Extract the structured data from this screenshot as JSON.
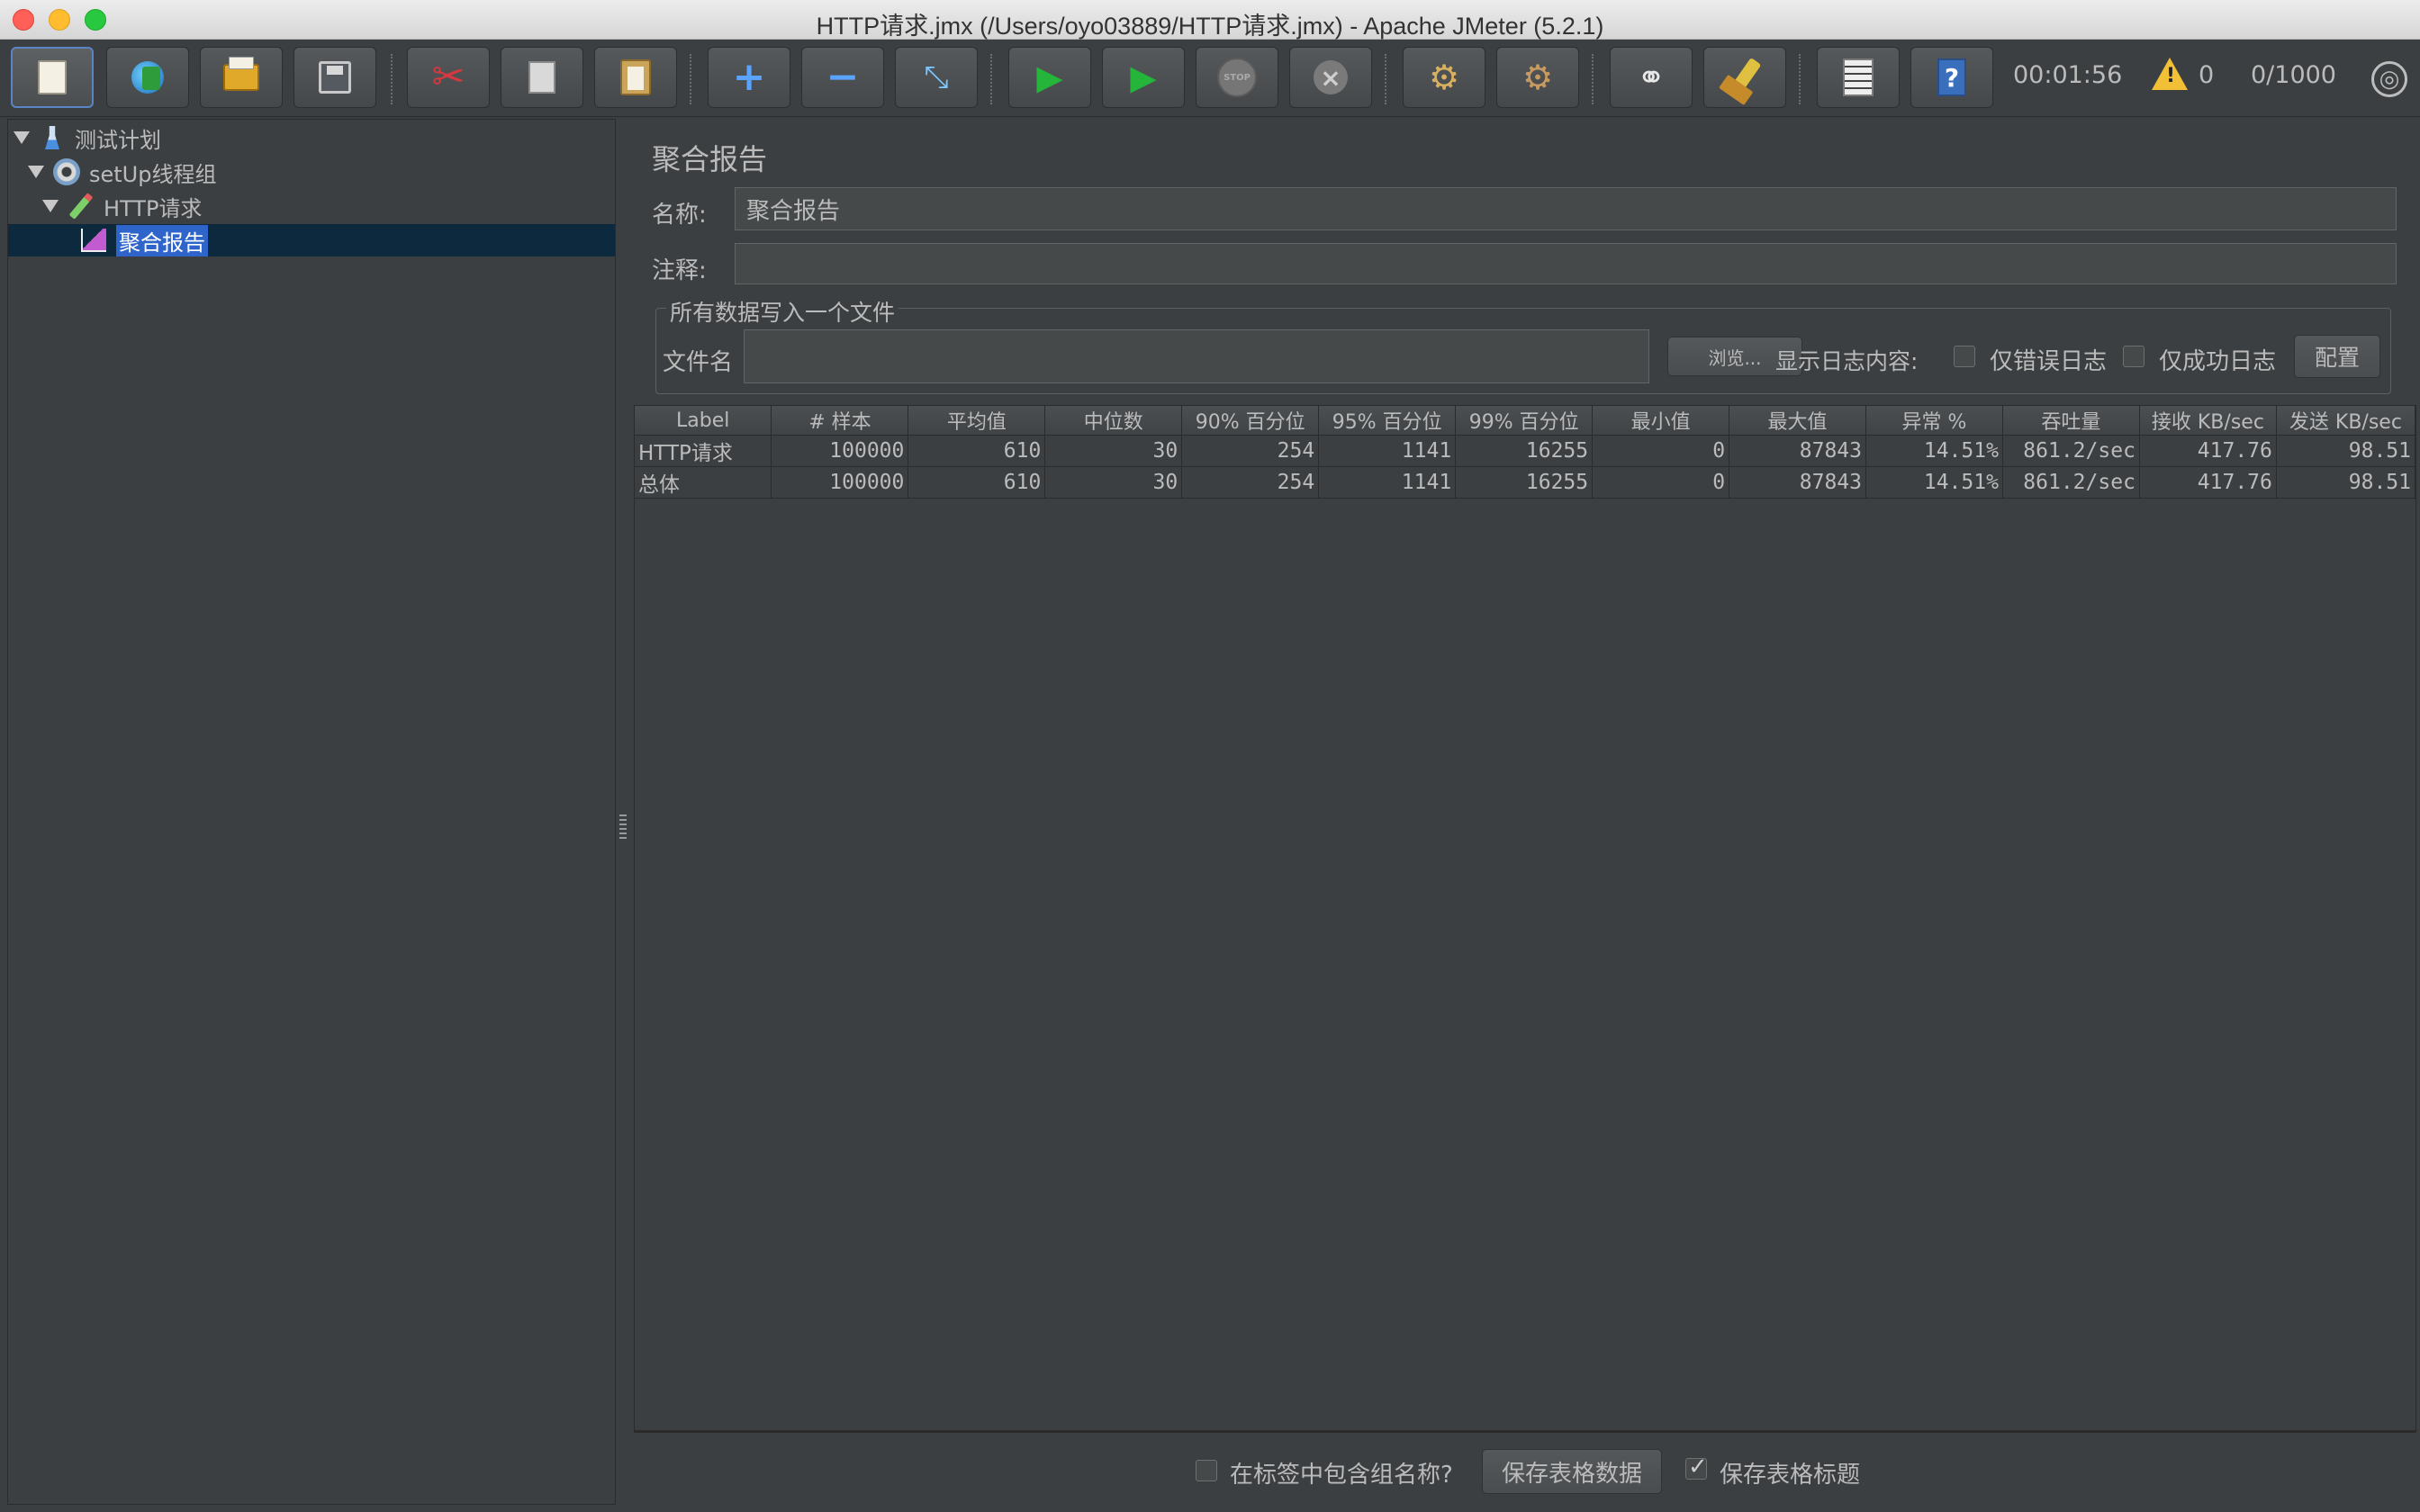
{
  "window": {
    "title": "HTTP请求.jmx (/Users/oyo03889/HTTP请求.jmx) - Apache JMeter (5.2.1)"
  },
  "toolbar": {
    "buttons": [
      {
        "name": "new-icon",
        "tooltip": "New"
      },
      {
        "name": "templates-icon",
        "tooltip": "Templates"
      },
      {
        "name": "open-icon",
        "tooltip": "Open"
      },
      {
        "name": "save-icon",
        "tooltip": "Save"
      },
      {
        "name": "cut-icon",
        "tooltip": "Cut"
      },
      {
        "name": "copy-icon",
        "tooltip": "Copy"
      },
      {
        "name": "paste-icon",
        "tooltip": "Paste"
      },
      {
        "name": "expand-icon",
        "tooltip": "Expand All"
      },
      {
        "name": "collapse-icon",
        "tooltip": "Collapse All"
      },
      {
        "name": "toggle-icon",
        "tooltip": "Toggle"
      },
      {
        "name": "start-icon",
        "tooltip": "Start"
      },
      {
        "name": "start-no-pause-icon",
        "tooltip": "Start no pauses"
      },
      {
        "name": "stop-icon",
        "tooltip": "Stop"
      },
      {
        "name": "shutdown-icon",
        "tooltip": "Shutdown"
      },
      {
        "name": "clear-icon",
        "tooltip": "Clear"
      },
      {
        "name": "clear-all-icon",
        "tooltip": "Clear All"
      },
      {
        "name": "search-icon",
        "tooltip": "Search"
      },
      {
        "name": "reset-search-icon",
        "tooltip": "Reset Search"
      },
      {
        "name": "function-helper-icon",
        "tooltip": "Function Helper"
      },
      {
        "name": "help-icon",
        "tooltip": "Help"
      }
    ],
    "timer": "00:01:56",
    "warning_count": "0",
    "threads": "0/1000"
  },
  "tree": {
    "items": [
      {
        "label": "测试计划",
        "icon": "flask-icon"
      },
      {
        "label": "setUp线程组",
        "icon": "gear-icon"
      },
      {
        "label": "HTTP请求",
        "icon": "pen-icon"
      },
      {
        "label": "聚合报告",
        "icon": "chart-icon",
        "selected": true
      }
    ]
  },
  "panel": {
    "title": "聚合报告",
    "name_label": "名称:",
    "name_value": "聚合报告",
    "comment_label": "注释:",
    "comment_value": "",
    "file_group_label": "所有数据写入一个文件",
    "filename_label": "文件名",
    "filename_value": "",
    "browse_label": "浏览...",
    "log_content_label": "显示日志内容:",
    "errors_only_label": "仅错误日志",
    "success_only_label": "仅成功日志",
    "configure_label": "配置"
  },
  "table": {
    "headers": [
      "Label",
      "# 样本",
      "平均值",
      "中位数",
      "90% 百分位",
      "95% 百分位",
      "99% 百分位",
      "最小值",
      "最大值",
      "异常 %",
      "吞吐量",
      "接收 KB/sec",
      "发送 KB/sec"
    ],
    "rows": [
      [
        "HTTP请求",
        "100000",
        "610",
        "30",
        "254",
        "1141",
        "16255",
        "0",
        "87843",
        "14.51%",
        "861.2/sec",
        "417.76",
        "98.51"
      ],
      [
        "总体",
        "100000",
        "610",
        "30",
        "254",
        "1141",
        "16255",
        "0",
        "87843",
        "14.51%",
        "861.2/sec",
        "417.76",
        "98.51"
      ]
    ]
  },
  "bottom": {
    "include_group_label": "在标签中包含组名称?",
    "include_group_checked": false,
    "save_table_label": "保存表格数据",
    "save_header_label": "保存表格标题",
    "save_header_checked": true
  }
}
